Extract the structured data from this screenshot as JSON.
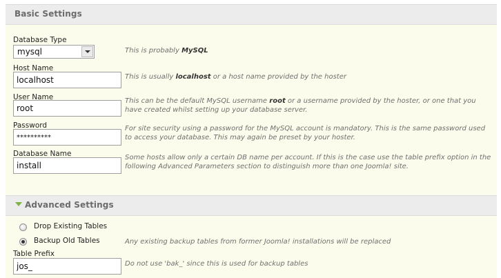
{
  "basic_settings": {
    "title": "Basic Settings",
    "database_type": {
      "label": "Database Type",
      "value": "mysql",
      "help_prefix": "This is probably ",
      "help_bold": "MySQL"
    },
    "host_name": {
      "label": "Host Name",
      "value": "localhost",
      "help_prefix": "This is usually ",
      "help_bold": "localhost",
      "help_suffix": " or a host name provided by the hoster"
    },
    "user_name": {
      "label": "User Name",
      "value": "root",
      "help_line1_prefix": "This can be the default MySQL username ",
      "help_bold": "root",
      "help_line1_suffix": " or a username provided by the hoster, or one that you",
      "help_line2": "have created whilst setting up your database server."
    },
    "password": {
      "label": "Password",
      "value": "**********",
      "help_line1": "For site security using a password for the MySQL account is mandatory. This is the same password used",
      "help_line2": "to access your database. This may again be preset by your hoster."
    },
    "database_name": {
      "label": "Database Name",
      "value": "install",
      "help_line1": "Some hosts allow only a certain DB name per account. If this is the case use the table prefix option in the",
      "help_line2": "following Advanced Parameters section to distinguish more than one Joomla! site."
    }
  },
  "advanced_settings": {
    "title": "Advanced Settings",
    "drop_existing_tables": {
      "label": "Drop Existing Tables",
      "checked": false
    },
    "backup_old_tables": {
      "label": "Backup Old Tables",
      "checked": true,
      "help": "Any existing backup tables from former Joomla! installations will be replaced"
    },
    "table_prefix": {
      "label": "Table Prefix",
      "value": "jos_",
      "help": "Do not use 'bak_' since this is used for backup tables"
    }
  },
  "colors": {
    "panel_bg": "#fcfcec",
    "header_bg": "#ececec",
    "chevron": "#7cb342"
  }
}
